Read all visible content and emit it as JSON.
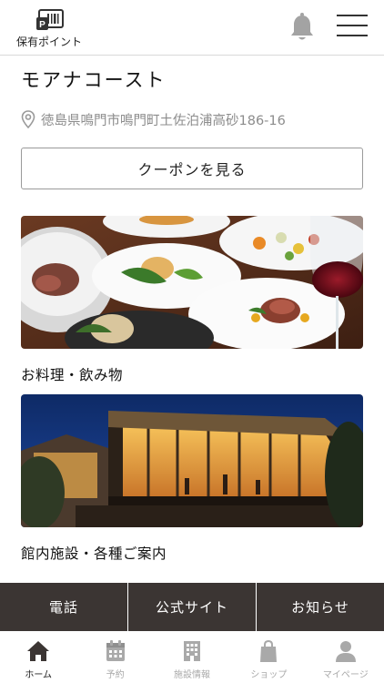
{
  "header": {
    "points_label": "保有ポイント",
    "points_icon": "points-card-icon",
    "notification_icon": "bell-icon",
    "menu_icon": "hamburger-menu-icon"
  },
  "facility": {
    "name": "モアナコースト",
    "address": "徳島県鳴門市鳴門町土佐泊浦高砂186-16",
    "address_icon": "location-pin-icon"
  },
  "coupon_button": {
    "label": "クーポンを見る"
  },
  "cards": [
    {
      "label": "お料理・飲み物",
      "image": "dining-dishes-wine-photo"
    },
    {
      "label": "館内施設・各種ご案内",
      "image": "building-exterior-night-photo"
    }
  ],
  "action_bar": {
    "phone_label": "電話",
    "website_label": "公式サイト",
    "news_label": "お知らせ"
  },
  "tabbar": {
    "active_color": "#3b3533",
    "inactive_color": "#a9a9a9",
    "items": [
      {
        "label": "ホーム",
        "icon": "home-icon",
        "active": true
      },
      {
        "label": "予約",
        "icon": "calendar-icon",
        "active": false
      },
      {
        "label": "施設情報",
        "icon": "building-icon",
        "active": false
      },
      {
        "label": "ショップ",
        "icon": "shopping-bag-icon",
        "active": false
      },
      {
        "label": "マイページ",
        "icon": "user-icon",
        "active": false
      }
    ]
  }
}
